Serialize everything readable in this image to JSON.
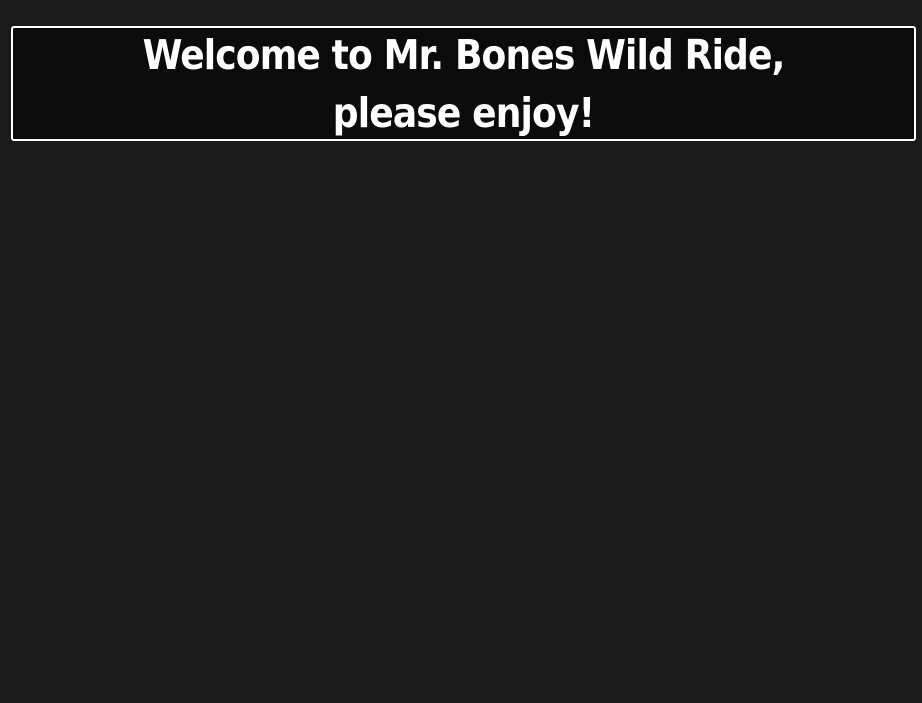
{
  "banner": {
    "title": "Welcome to Mr. Bones Wild Ride, please enjoy!"
  },
  "colors": {
    "page_background": "#1b1b1b",
    "banner_background": "#0b0b0b",
    "banner_border": "#ffffff",
    "banner_text": "#ffffff"
  }
}
